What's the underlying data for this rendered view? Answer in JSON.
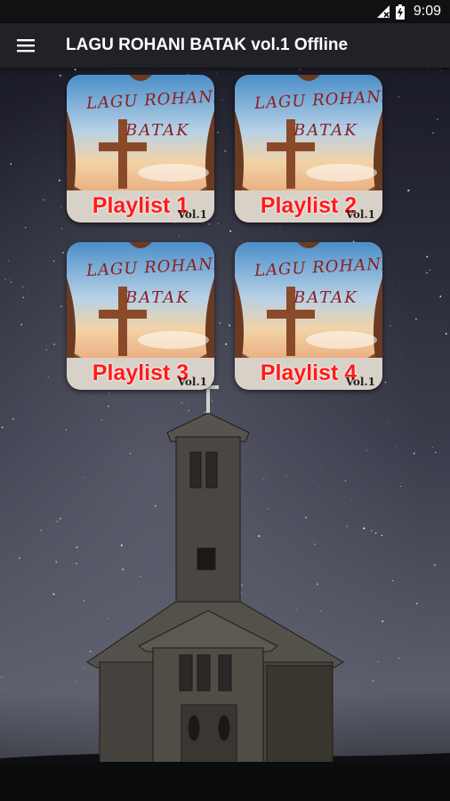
{
  "status_bar": {
    "time": "9:09",
    "icons": [
      "signal-icon",
      "battery-icon"
    ]
  },
  "app_bar": {
    "title": "LAGU ROHANI BATAK vol.1 Offline",
    "menu_icon": "menu-icon"
  },
  "playlists": [
    {
      "label": "Playlist 1",
      "art_title_line1": "LAGU ROHANI",
      "art_title_line2": "BATAK",
      "badge": "Vol.1"
    },
    {
      "label": "Playlist 2",
      "art_title_line1": "LAGU ROHANI",
      "art_title_line2": "BATAK",
      "badge": "Vol.1"
    },
    {
      "label": "Playlist 3",
      "art_title_line1": "LAGU ROHANI",
      "art_title_line2": "BATAK",
      "badge": "Vol.1"
    },
    {
      "label": "Playlist 4",
      "art_title_line1": "LAGU ROHANI",
      "art_title_line2": "BATAK",
      "badge": "Vol.1"
    }
  ],
  "colors": {
    "accent_red": "#ff1a1a",
    "app_bar": "#202226",
    "status_bar": "#111111"
  }
}
